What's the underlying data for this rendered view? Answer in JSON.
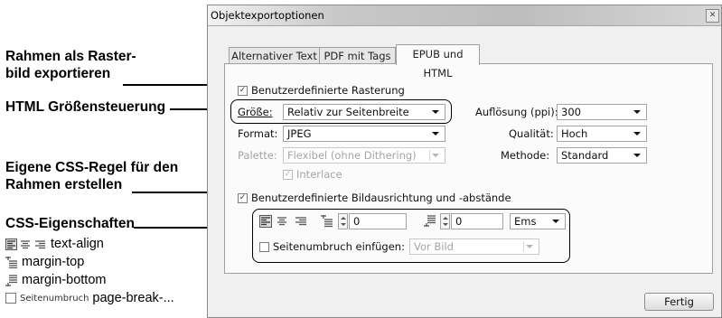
{
  "annotations": {
    "raster_line1": "Rahmen als Raster-",
    "raster_line2": "bild exportieren",
    "html_size": "HTML Größensteuerung",
    "css_line1": "Eigene CSS-Regel für den",
    "css_line2": "Rahmen erstellen",
    "css_props": "CSS-Eigenschaften",
    "legend": [
      {
        "text": "text-align"
      },
      {
        "text": "margin-top"
      },
      {
        "text": "margin-bottom"
      },
      {
        "chip": "Seitenumbruch",
        "text": "page-break-..."
      }
    ]
  },
  "dialog": {
    "title": "Objektexportoptionen",
    "tabs": [
      "Alternativer Text",
      "PDF mit Tags",
      "EPUB und HTML"
    ],
    "active_tab": "EPUB und HTML",
    "raster_checkbox": {
      "label": "Benutzerdefinierte Rasterung",
      "checked": true
    },
    "groesse": {
      "label": "Größe:",
      "value": "Relativ zur Seitenbreite"
    },
    "format": {
      "label": "Format:",
      "value": "JPEG"
    },
    "palette": {
      "label": "Palette:",
      "value": "Flexibel (ohne Dithering)",
      "enabled": false
    },
    "interlace": {
      "label": "Interlace",
      "checked": true,
      "enabled": false
    },
    "aufloesung": {
      "label": "Auflösung (ppi):",
      "value": "300"
    },
    "qualitaet": {
      "label": "Qualität:",
      "value": "Hoch"
    },
    "methode": {
      "label": "Methode:",
      "value": "Standard"
    },
    "layout_checkbox": {
      "label": "Benutzerdefinierte Bildausrichtung und -abstände",
      "checked": true
    },
    "margin_top": "0",
    "margin_bottom": "0",
    "units": "Ems",
    "pagebreak_checkbox": {
      "label": "Seitenumbruch einfügen:",
      "checked": false
    },
    "pagebreak_select": "Vor Bild",
    "done_button": "Fertig"
  },
  "colors": {
    "dialog_bg": "#f0f0f0",
    "panel_bg": "#fbfbfb",
    "annotation_ink": "#000000"
  }
}
